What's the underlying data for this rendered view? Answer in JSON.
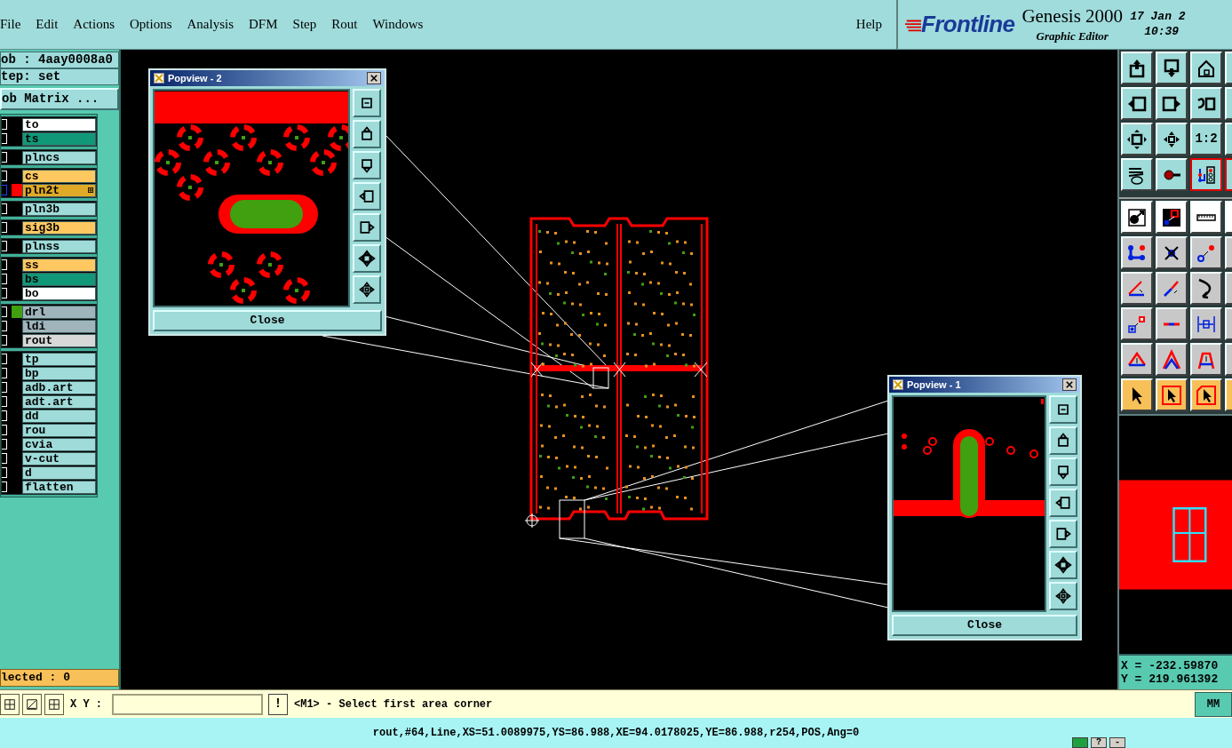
{
  "menu": [
    {
      "label": "File"
    },
    {
      "label": "Edit"
    },
    {
      "label": "Actions"
    },
    {
      "label": "Options"
    },
    {
      "label": "Analysis"
    },
    {
      "label": "DFM"
    },
    {
      "label": "Step"
    },
    {
      "label": "Rout"
    },
    {
      "label": "Windows"
    }
  ],
  "help": "Help",
  "brand": {
    "logo": "Frontline",
    "product": "Genesis 2000",
    "subtitle": "Graphic Editor",
    "date": "17 Jan 2",
    "time": "10:39"
  },
  "job": {
    "job": "ob : 4aay0008a0",
    "step": "tep: set",
    "matrix_button": "ob Matrix ...",
    "selected_count": "lected : 0"
  },
  "layer_groups": [
    [
      {
        "name": "to",
        "color": "#ffffff",
        "selected": false
      },
      {
        "name": "ts",
        "color": "#109878",
        "selected": false
      }
    ],
    [
      {
        "name": "plncs",
        "color": "#9edbd9",
        "selected": false
      }
    ],
    [
      {
        "name": "cs",
        "color": "#ffc860",
        "selected": false
      },
      {
        "name": "pln2t",
        "color": "#e0aa28",
        "selected": true,
        "swatch": {
          "color": "#ff0000"
        }
      }
    ],
    [
      {
        "name": "pln3b",
        "color": "#9edbd9",
        "selected": false
      }
    ],
    [
      {
        "name": "sig3b",
        "color": "#ffc860",
        "selected": false
      }
    ],
    [
      {
        "name": "plnss",
        "color": "#9edbd9",
        "selected": false
      }
    ],
    [
      {
        "name": "ss",
        "color": "#ffc860",
        "selected": false
      },
      {
        "name": "bs",
        "color": "#109878",
        "selected": false
      },
      {
        "name": "bo",
        "color": "#ffffff",
        "selected": false
      }
    ],
    [
      {
        "name": "drl",
        "color": "#a0b4bc",
        "selected": false,
        "swatch": {
          "color": "#40a010"
        }
      },
      {
        "name": "ldi",
        "color": "#a0b4bc",
        "selected": false
      },
      {
        "name": "rout",
        "color": "#d8d8d8",
        "selected": false
      }
    ],
    [
      {
        "name": "tp",
        "color": "#9edbd9",
        "selected": false
      },
      {
        "name": "bp",
        "color": "#9edbd9",
        "selected": false
      },
      {
        "name": "adb.art",
        "color": "#9edbd9",
        "selected": false
      },
      {
        "name": "adt.art",
        "color": "#9edbd9",
        "selected": false
      },
      {
        "name": "dd",
        "color": "#9edbd9",
        "selected": false
      },
      {
        "name": "rou",
        "color": "#9edbd9",
        "selected": false
      },
      {
        "name": "cvia",
        "color": "#9edbd9",
        "selected": false
      },
      {
        "name": "v-cut",
        "color": "#9edbd9",
        "selected": false
      },
      {
        "name": "d",
        "color": "#9edbd9",
        "selected": false
      },
      {
        "name": "flatten",
        "color": "#9edbd9",
        "selected": false
      }
    ]
  ],
  "popviews": [
    {
      "title": "Popview - 2",
      "kind": "vias",
      "close": "Close"
    },
    {
      "title": "Popview - 1",
      "kind": "slot",
      "close": "Close"
    }
  ],
  "tool_sections": [
    {
      "kind": "view",
      "rows": [
        [
          {
            "kind": "layer-up",
            "selected": false
          },
          {
            "kind": "layer-down",
            "selected": false
          },
          {
            "kind": "home",
            "selected": false
          },
          {
            "kind": "partial",
            "selected": false
          }
        ],
        [
          {
            "kind": "move-left",
            "selected": false
          },
          {
            "kind": "move-right",
            "selected": false
          },
          {
            "kind": "undo-box",
            "selected": false
          },
          {
            "kind": "partial",
            "selected": false
          }
        ],
        [
          {
            "kind": "fit",
            "selected": false
          },
          {
            "kind": "pan",
            "selected": false
          },
          {
            "kind": "ratio",
            "label": "1:2",
            "selected": false
          },
          {
            "kind": "partial",
            "selected": false
          }
        ],
        [
          {
            "kind": "tools",
            "selected": false
          },
          {
            "kind": "probe",
            "selected": false
          },
          {
            "kind": "net",
            "selected": true
          },
          {
            "kind": "partial",
            "selected": true
          }
        ]
      ]
    },
    {
      "kind": "measure",
      "rows": [
        [
          {
            "kind": "dot-arrow",
            "selected": false
          },
          {
            "kind": "pad-box",
            "selected": false
          },
          {
            "kind": "ruler",
            "selected": false
          },
          {
            "kind": "partial",
            "selected": false
          }
        ]
      ]
    },
    {
      "kind": "edit",
      "rows": [
        [
          {
            "kind": "nodes",
            "selected": false
          },
          {
            "kind": "cross",
            "selected": false
          },
          {
            "kind": "link",
            "selected": false
          },
          {
            "kind": "partial",
            "selected": false
          }
        ],
        [
          {
            "kind": "angle",
            "selected": false
          },
          {
            "kind": "slant",
            "selected": false
          },
          {
            "kind": "curve",
            "selected": false
          },
          {
            "kind": "partial",
            "selected": false
          }
        ],
        [
          {
            "kind": "pad-link",
            "selected": false
          },
          {
            "kind": "segment",
            "selected": false
          },
          {
            "kind": "dimension",
            "selected": false
          },
          {
            "kind": "partial",
            "selected": false
          }
        ],
        [
          {
            "kind": "triangle",
            "selected": false
          },
          {
            "kind": "peak",
            "selected": false
          },
          {
            "kind": "arch",
            "selected": false
          },
          {
            "kind": "partial",
            "selected": false
          }
        ]
      ]
    },
    {
      "kind": "select",
      "rows": [
        [
          {
            "kind": "pointer",
            "selected": false
          },
          {
            "kind": "pointer-box",
            "selected": false
          },
          {
            "kind": "pointer-poly",
            "selected": false
          },
          {
            "kind": "partial",
            "selected": false
          }
        ]
      ]
    }
  ],
  "coords": {
    "x": "X = -232.59870",
    "y": "Y = 219.961392"
  },
  "command": {
    "xy_label": "X Y :",
    "alert": "!",
    "prompt": "<M1> - Select first area corner",
    "units": "MM"
  },
  "status": "rout,#64,Line,XS=51.0089975,YS=86.988,XE=94.0178025,YE=86.988,r254,POS,Ang=0",
  "tray": [
    {
      "label": "?"
    },
    {
      "label": "-"
    }
  ]
}
